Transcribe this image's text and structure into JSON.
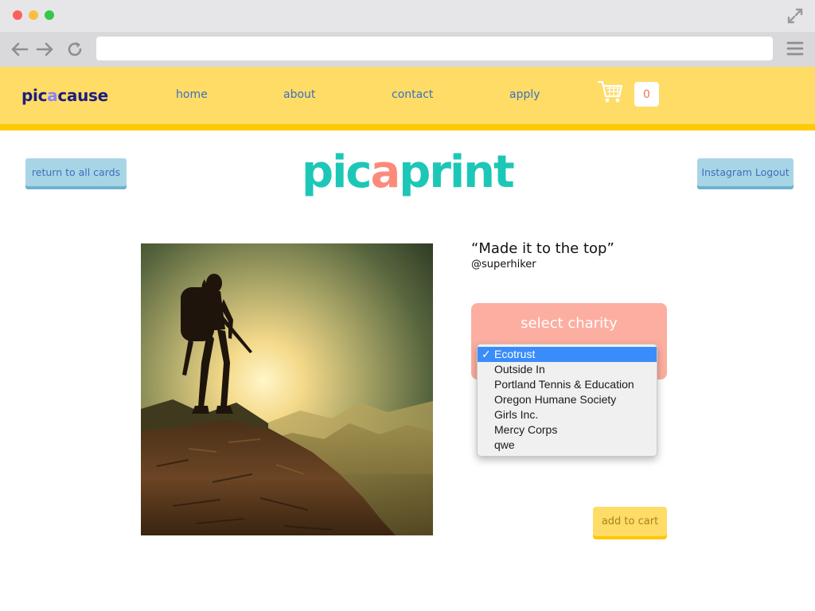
{
  "browser": {
    "url": ""
  },
  "header": {
    "logo_prefix": "pic",
    "logo_accent": "a",
    "logo_suffix": "cause",
    "nav": [
      {
        "label": "home"
      },
      {
        "label": "about"
      },
      {
        "label": "contact"
      },
      {
        "label": "apply"
      }
    ],
    "cart_count": "0"
  },
  "page": {
    "return_label": "return to all cards",
    "logout_label": "Instagram Logout",
    "title_prefix": "pic",
    "title_accent": "a",
    "title_suffix": "print",
    "caption": "“Made it to the top”",
    "handle": "@superhiker",
    "charity_title": "select charity",
    "charity_options": [
      {
        "label": "Ecotrust",
        "selected": true
      },
      {
        "label": "Outside In"
      },
      {
        "label": "Portland Tennis & Education"
      },
      {
        "label": "Oregon Humane Society"
      },
      {
        "label": "Girls Inc."
      },
      {
        "label": "Mercy Corps"
      },
      {
        "label": "qwe"
      }
    ],
    "checkmark": "✓",
    "add_to_cart_label": "add to cart"
  },
  "colors": {
    "header_bg": "#fedc66",
    "header_border": "#fec804",
    "logo": "#1c1d7e",
    "logo_accent": "#8b83ff",
    "title": "#1dc7b7",
    "title_accent": "#fc8a7b",
    "charity_box": "#fcaea0",
    "selection": "#3a8cfb"
  }
}
